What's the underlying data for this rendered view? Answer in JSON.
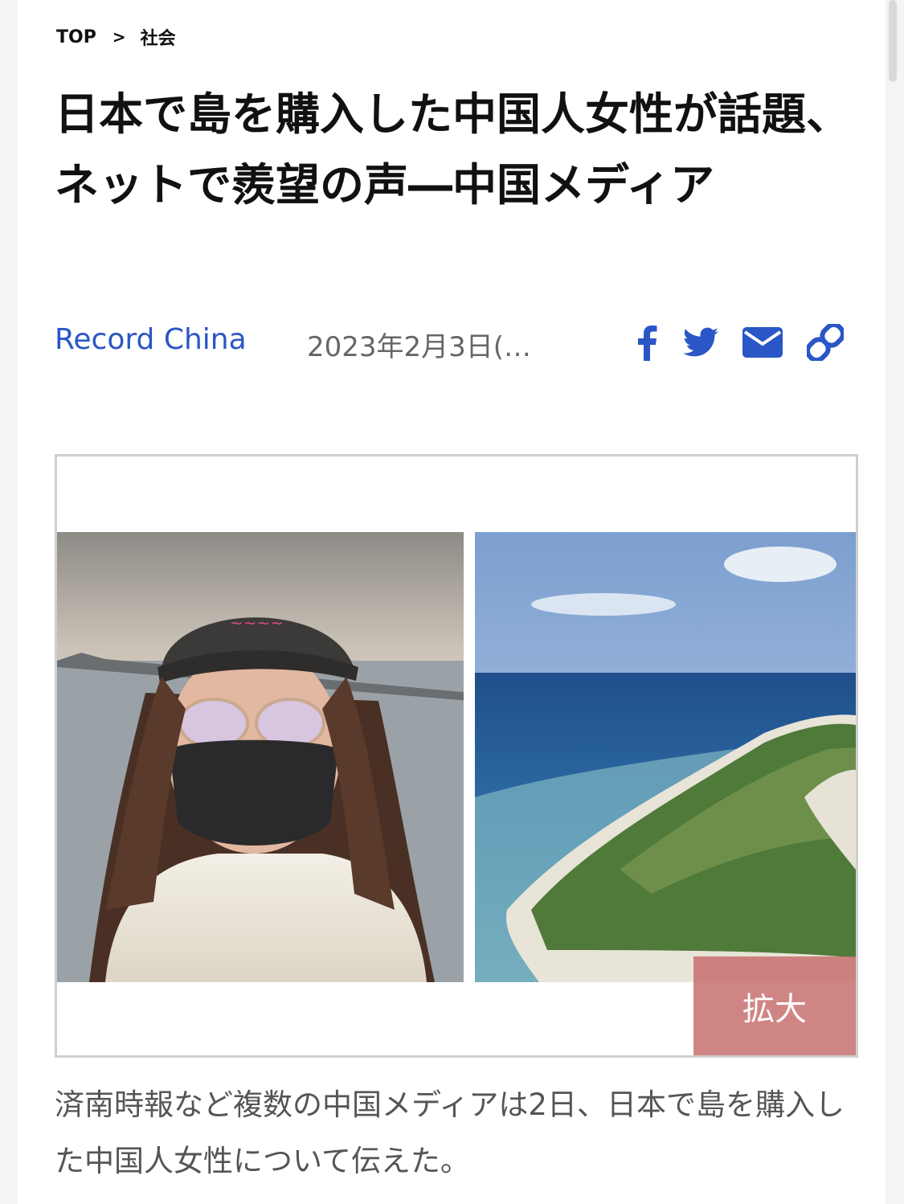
{
  "breadcrumb": {
    "home": "TOP",
    "separator": ">",
    "category": "社会"
  },
  "article": {
    "title": "日本で島を購入した中国人女性が話題、ネットで羨望の声―中国メディア",
    "source": "Record China",
    "date": "2023年2月3日(…",
    "lead": "済南時報など複数の中国メディアは2日、日本で島を購入した中国人女性について伝えた。"
  },
  "share": {
    "icons": [
      "facebook-icon",
      "twitter-icon",
      "mail-icon",
      "link-icon"
    ],
    "color": "#2a56c6"
  },
  "figure": {
    "enlarge_label": "拡大"
  },
  "colors": {
    "accent": "#2a56c6",
    "enlarge_bg": "#c87070",
    "text": "#111111",
    "muted": "#555555"
  }
}
